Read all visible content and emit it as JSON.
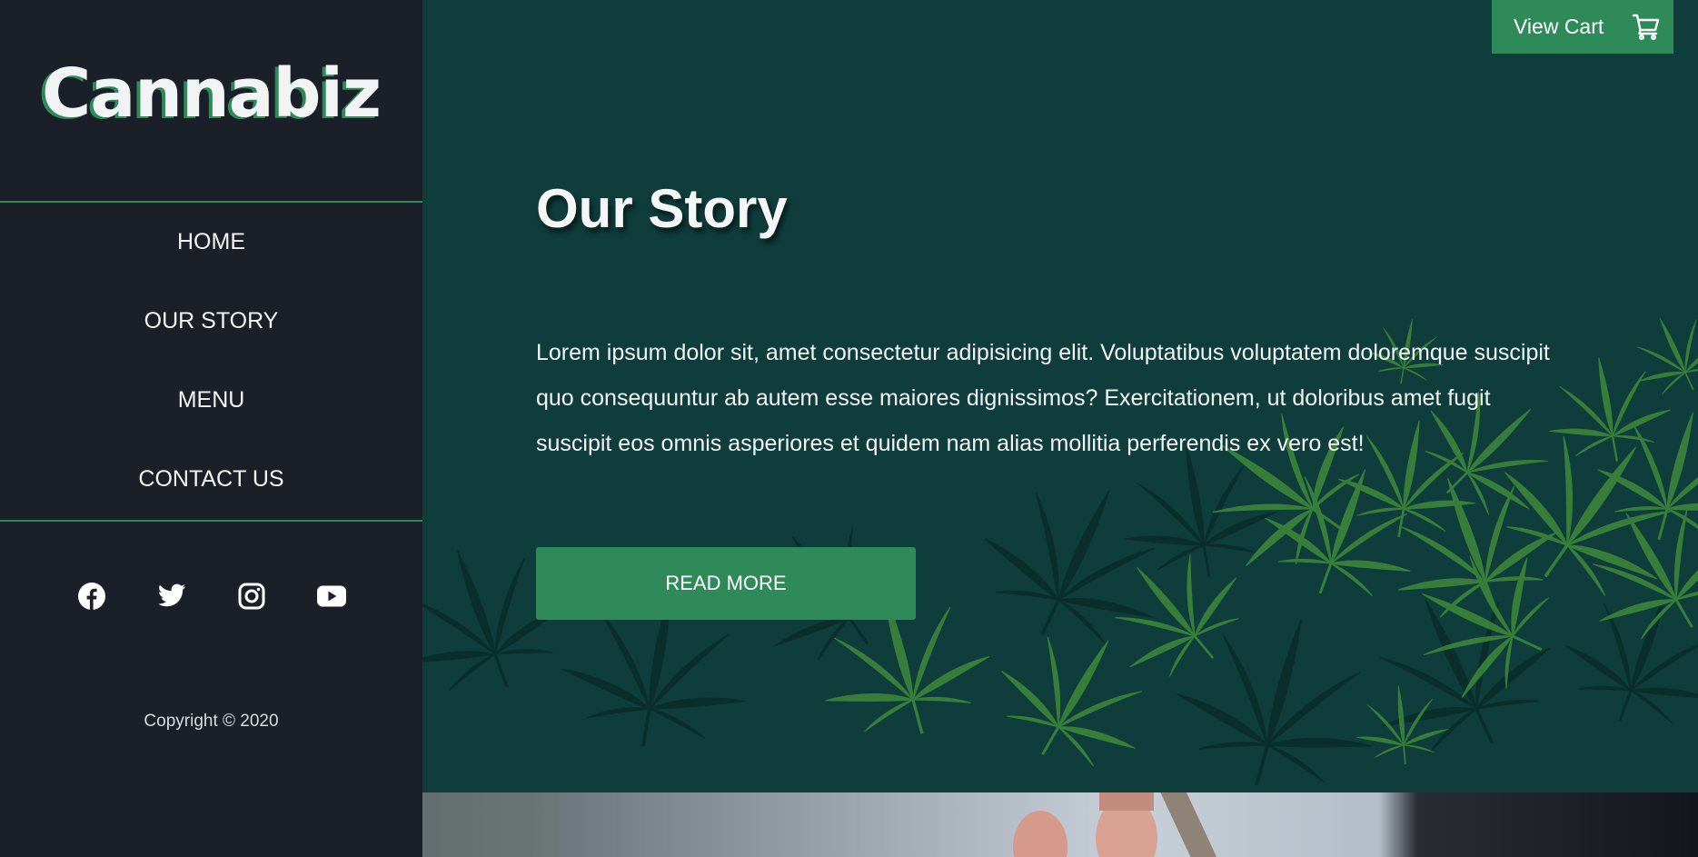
{
  "brand": {
    "logo_text": "Cannabiz"
  },
  "nav": {
    "items": [
      {
        "label": "HOME"
      },
      {
        "label": "OUR STORY"
      },
      {
        "label": "MENU"
      },
      {
        "label": "CONTACT US"
      }
    ]
  },
  "social": {
    "icons": [
      "facebook-icon",
      "twitter-icon",
      "instagram-icon",
      "youtube-icon"
    ]
  },
  "footer": {
    "copyright": "Copyright © 2020"
  },
  "header": {
    "cart_label": "View Cart",
    "cart_icon": "shopping-cart-icon"
  },
  "hero": {
    "title": "Our Story",
    "body": "Lorem ipsum dolor sit, amet consectetur adipisicing elit. Voluptatibus voluptatem doloremque suscipit quo consequuntur ab autem esse maiores dignissimos? Exercitationem, ut doloribus amet fugit suscipit eos omnis asperiores et quidem nam alias mollitia perferendis ex vero est!",
    "button_label": "READ MORE"
  },
  "colors": {
    "sidebar_bg": "#1b1f27",
    "hero_bg": "#0f3d3b",
    "accent": "#2e8a58",
    "text": "#f4f7f6"
  }
}
